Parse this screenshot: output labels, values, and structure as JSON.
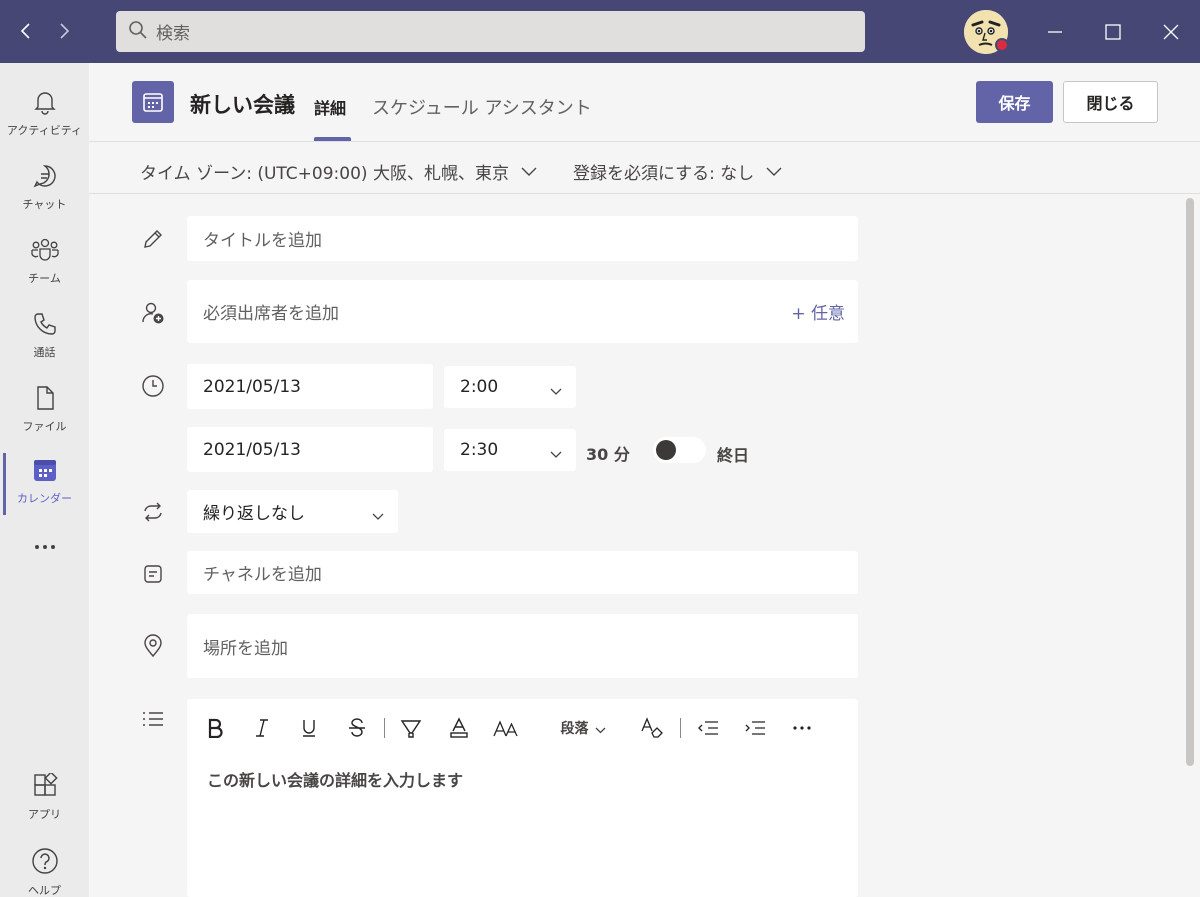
{
  "search": {
    "placeholder": "検索"
  },
  "rail": {
    "items": [
      {
        "label": "アクティビティ",
        "icon": "bell-icon"
      },
      {
        "label": "チャット",
        "icon": "chat-icon"
      },
      {
        "label": "チーム",
        "icon": "teams-icon"
      },
      {
        "label": "通話",
        "icon": "phone-icon"
      },
      {
        "label": "ファイル",
        "icon": "file-icon"
      },
      {
        "label": "カレンダー",
        "icon": "calendar-icon",
        "active": true
      }
    ],
    "more": "...",
    "bottom": [
      {
        "label": "アプリ",
        "icon": "apps-icon"
      },
      {
        "label": "ヘルプ",
        "icon": "help-icon"
      }
    ]
  },
  "header": {
    "title": "新しい会議",
    "tab_details": "詳細",
    "tab_schedule": "スケジュール アシスタント",
    "save_label": "保存",
    "close_label": "閉じる"
  },
  "options": {
    "timezone": "タイム ゾーン: (UTC+09:00) 大阪、札幌、東京",
    "registration": "登録を必須にする: なし"
  },
  "form": {
    "title_placeholder": "タイトルを追加",
    "attendees_placeholder": "必須出席者を追加",
    "optional_label": "+ 任意",
    "start_date": "2021/05/13",
    "start_time": "2:00",
    "end_date": "2021/05/13",
    "end_time": "2:30",
    "duration": "30 分",
    "all_day_label": "終日",
    "all_day_on": false,
    "repeat": "繰り返しなし",
    "channel_placeholder": "チャネルを追加",
    "location_placeholder": "場所を追加"
  },
  "editor": {
    "paragraph_label": "段落",
    "placeholder": "この新しい会議の詳細を入力します",
    "more": "..."
  },
  "colors": {
    "brand": "#6264a7",
    "titlebar": "#464775",
    "presence_busy": "#d92c3f"
  }
}
